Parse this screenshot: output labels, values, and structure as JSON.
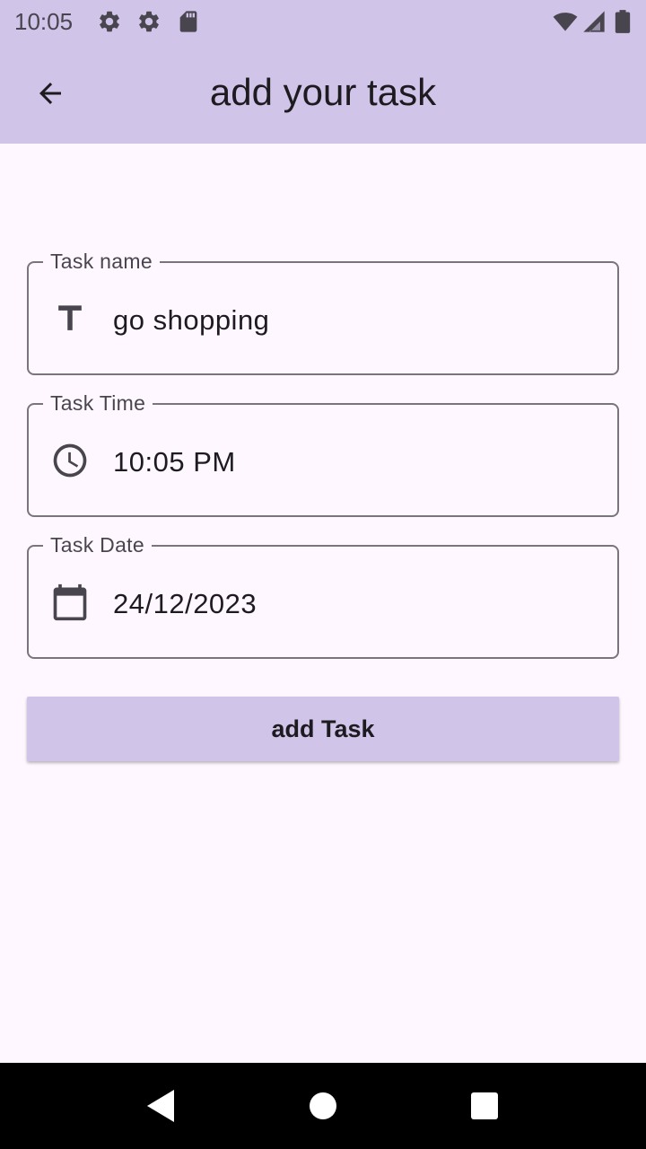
{
  "status_bar": {
    "time": "10:05",
    "left_icons": [
      "gear-icon",
      "gear-icon",
      "sd-card-icon"
    ],
    "right_icons": [
      "wifi-icon",
      "cell-signal-icon",
      "battery-icon"
    ]
  },
  "app_bar": {
    "title": "add your task",
    "back_icon": "arrow-back-icon",
    "background": "#d0c4e8"
  },
  "form": {
    "fields": [
      {
        "label": "Task name",
        "value": "go shopping",
        "icon": "text-fields-icon"
      },
      {
        "label": "Task Time",
        "value": "10:05 PM",
        "icon": "clock-icon"
      },
      {
        "label": "Task Date",
        "value": "24/12/2023",
        "icon": "calendar-icon"
      }
    ],
    "submit_label": "add Task"
  },
  "nav_bar": {
    "icons": [
      "nav-back-icon",
      "nav-home-icon",
      "nav-recents-icon"
    ]
  },
  "colors": {
    "accent": "#d0c4e8",
    "background": "#fef7ff",
    "text": "#1d1b20",
    "border": "#79747e"
  }
}
